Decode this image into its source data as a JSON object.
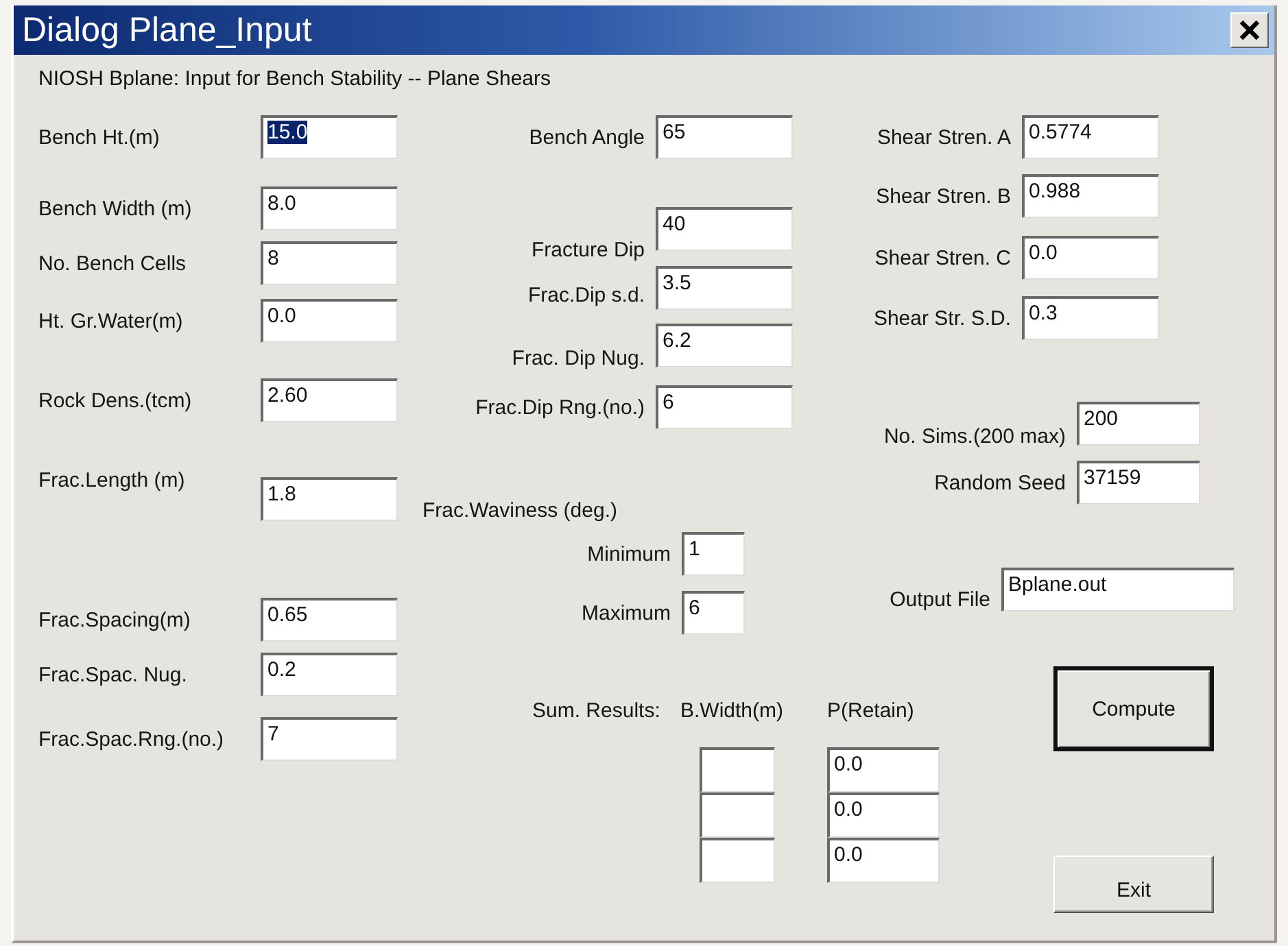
{
  "window": {
    "title": "Dialog Plane_Input"
  },
  "heading": "NIOSH Bplane: Input for Bench Stability -- Plane Shears",
  "left_fields": [
    {
      "label": "Bench Ht.(m)",
      "value": "15.0",
      "text_selected": true
    },
    {
      "label": "Bench Width (m)",
      "value": "8.0",
      "text_selected": false
    },
    {
      "label": "No. Bench Cells",
      "value": "8",
      "text_selected": false
    },
    {
      "label": "Ht. Gr.Water(m)",
      "value": "0.0",
      "text_selected": false
    },
    {
      "label": "Rock Dens.(tcm)",
      "value": "2.60",
      "text_selected": false
    },
    {
      "label": "Frac.Length (m)",
      "value": "1.8",
      "text_selected": false
    },
    {
      "label": "Frac.Spacing(m)",
      "value": "0.65",
      "text_selected": false
    },
    {
      "label": "Frac.Spac. Nug.",
      "value": "0.2",
      "text_selected": false
    },
    {
      "label": "Frac.Spac.Rng.(no.)",
      "value": "7",
      "text_selected": false
    }
  ],
  "middle_fields": [
    {
      "label": "Bench Angle",
      "value": "65"
    },
    {
      "label": "Fracture Dip",
      "value": "40"
    },
    {
      "label": "Frac.Dip s.d.",
      "value": "3.5"
    },
    {
      "label": "Frac. Dip Nug.",
      "value": "6.2"
    },
    {
      "label": "Frac.Dip Rng.(no.)",
      "value": "6"
    }
  ],
  "waviness": {
    "label": "Frac.Waviness (deg.)",
    "fields": [
      {
        "label": "Minimum",
        "value": "1"
      },
      {
        "label": "Maximum",
        "value": "6"
      }
    ]
  },
  "results": {
    "label": "Sum. Results:",
    "columns": [
      "B.Width(m)",
      "P(Retain)"
    ],
    "rows": [
      {
        "p_retain": "0.0"
      },
      {
        "p_retain": "0.0"
      },
      {
        "p_retain": "0.0"
      }
    ]
  },
  "shear_fields": [
    {
      "label": "Shear Stren. A",
      "value": "0.5774"
    },
    {
      "label": "Shear Stren. B",
      "value": "0.988"
    },
    {
      "label": "Shear Stren. C",
      "value": "0.0"
    },
    {
      "label": "Shear Str. S.D.",
      "value": "0.3"
    }
  ],
  "sim_fields": [
    {
      "label": "No. Sims.(200 max)",
      "value": "200"
    },
    {
      "label": "Random Seed",
      "value": "37159"
    }
  ],
  "output_file": {
    "label": "Output File",
    "value": "Bplane.out"
  },
  "buttons": [
    {
      "label": "Compute",
      "default": true
    },
    {
      "label": "Exit",
      "default": false
    }
  ]
}
